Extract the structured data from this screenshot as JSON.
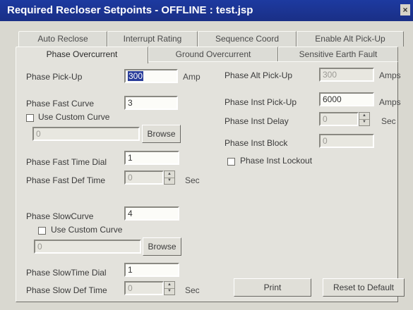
{
  "window": {
    "title": "Required Recloser Setpoints - OFFLINE : test.jsp",
    "close_label": "×"
  },
  "tabs_row1": [
    {
      "label": "Auto Reclose"
    },
    {
      "label": "Interrupt Rating"
    },
    {
      "label": "Sequence Coord"
    },
    {
      "label": "Enable Alt Pick-Up"
    }
  ],
  "tabs_row2": [
    {
      "label": "Phase Overcurrent",
      "active": true
    },
    {
      "label": "Ground Overcurrent"
    },
    {
      "label": "Sensitive Earth Fault"
    }
  ],
  "left": {
    "pickup": {
      "label": "Phase Pick-Up",
      "value": "300",
      "unit": "Amp"
    },
    "fast_curve": {
      "label": "Phase Fast Curve",
      "value": "3"
    },
    "fast_custom_checkbox": {
      "label": "Use Custom Curve",
      "checked": false
    },
    "fast_custom_field": {
      "value": "0"
    },
    "fast_browse": {
      "label": "Browse"
    },
    "fast_time_dial": {
      "label": "Phase Fast Time Dial",
      "value": "1"
    },
    "fast_def_time": {
      "label": "Phase Fast Def Time",
      "value": "0",
      "unit": "Sec"
    },
    "slow_curve": {
      "label": "Phase SlowCurve",
      "value": "4"
    },
    "slow_custom_checkbox": {
      "label": "Use Custom Curve",
      "checked": false
    },
    "slow_custom_field": {
      "value": "0"
    },
    "slow_browse": {
      "label": "Browse"
    },
    "slow_time_dial": {
      "label": "Phase SlowTime Dial",
      "value": "1"
    },
    "slow_def_time": {
      "label": "Phase Slow Def Time",
      "value": "0",
      "unit": "Sec"
    }
  },
  "right": {
    "alt_pickup": {
      "label": "Phase Alt Pick-Up",
      "value": "300",
      "unit": "Amps"
    },
    "inst_pickup": {
      "label": "Phase Inst Pick-Up",
      "value": "6000",
      "unit": "Amps"
    },
    "inst_delay": {
      "label": "Phase Inst Delay",
      "value": "0",
      "unit": "Sec"
    },
    "inst_block": {
      "label": "Phase Inst Block",
      "value": "0"
    },
    "inst_lockout": {
      "label": "Phase Inst Lockout",
      "checked": false
    }
  },
  "buttons": {
    "print": "Print",
    "reset": "Reset to Default"
  }
}
